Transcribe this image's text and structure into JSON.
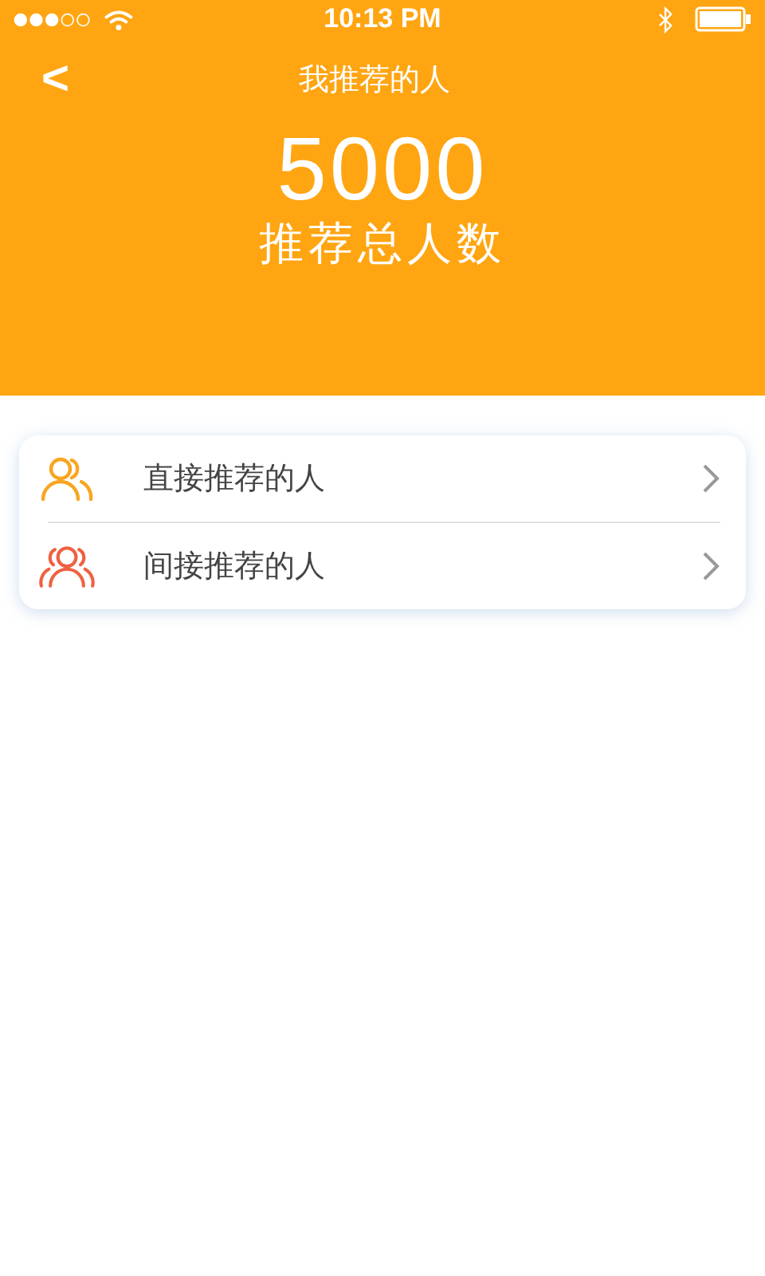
{
  "status_bar": {
    "time": "10:13 PM"
  },
  "nav": {
    "back": "<",
    "title": "我推荐的人"
  },
  "summary": {
    "count": "5000",
    "label": "推荐总人数"
  },
  "items": [
    {
      "kind": "direct",
      "label": "直接推荐的人"
    },
    {
      "kind": "indirect",
      "label": "间接推荐的人"
    }
  ]
}
